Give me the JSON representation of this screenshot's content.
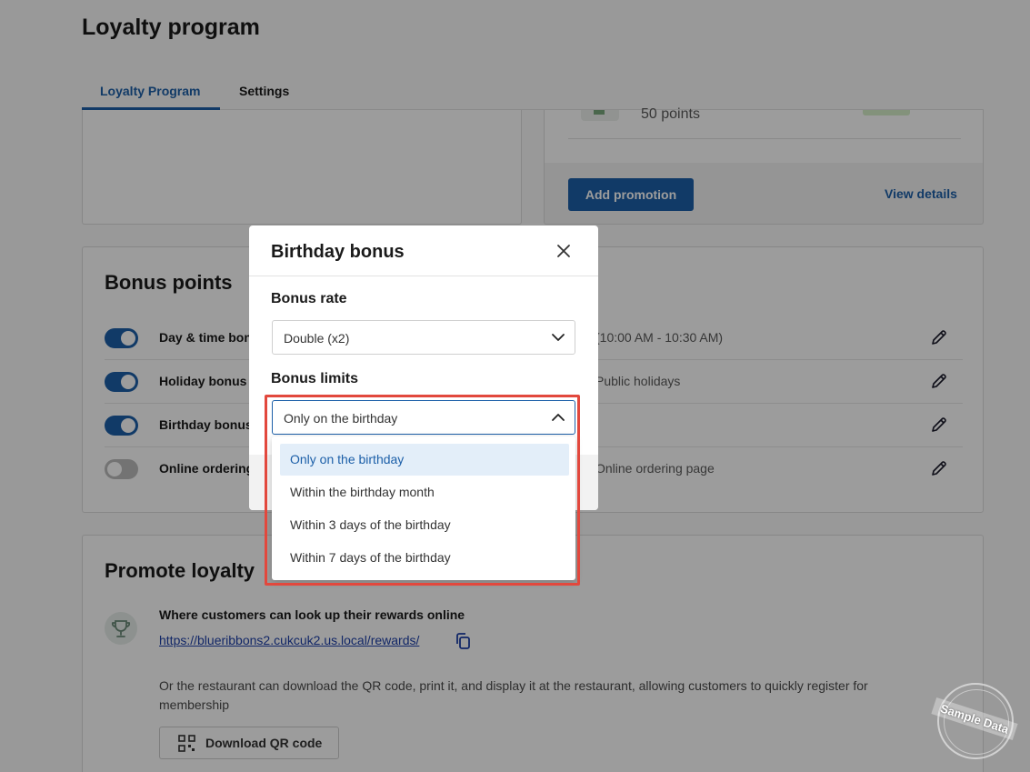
{
  "page": {
    "title": "Loyalty program"
  },
  "tabs": [
    {
      "label": "Loyalty Program",
      "active": true
    },
    {
      "label": "Settings",
      "active": false
    }
  ],
  "promotion": {
    "points": "50 points",
    "add_button": "Add promotion",
    "view_details": "View details"
  },
  "bonus_points": {
    "title": "Bonus points",
    "rows": [
      {
        "label": "Day & time bonus",
        "desc": "(10:00 AM - 10:30 AM)",
        "enabled": true
      },
      {
        "label": "Holiday bonus",
        "desc": "Public holidays",
        "enabled": true
      },
      {
        "label": "Birthday bonus",
        "desc": "",
        "enabled": true
      },
      {
        "label": "Online ordering",
        "desc": "Online ordering page",
        "enabled": false
      }
    ]
  },
  "promote_loyalty": {
    "title": "Promote loyalty",
    "lookup_text": "Where customers can look up their rewards online",
    "link": "https://blueribbons2.cukcuk2.us.local/rewards/",
    "qr_text": "Or the restaurant can download the QR code, print it, and display it at the restaurant, allowing customers to quickly register for membership",
    "qr_button": "Download QR code"
  },
  "modal": {
    "title": "Birthday bonus",
    "rate_label": "Bonus rate",
    "rate_value": "Double (x2)",
    "limits_label": "Bonus limits",
    "limits_value": "Only on the birthday",
    "options": [
      "Only on the birthday",
      "Within the birthday month",
      "Within 3 days of the birthday",
      "Within 7 days of the birthday"
    ],
    "selected_index": 0
  },
  "watermark": {
    "text": "Sample Data"
  },
  "colors": {
    "accent": "#1c5fa8",
    "highlight": "#e2483d"
  }
}
